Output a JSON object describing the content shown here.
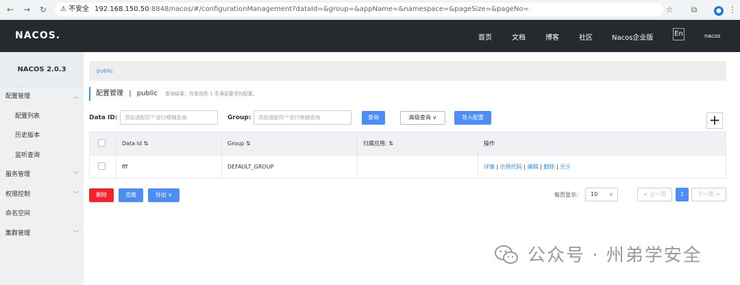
{
  "browser": {
    "security_label": "不安全",
    "url_host": "192.168.150.50",
    "url_rest": ":8848/nacos/#/configurationManagement?dataId=&group=&appName=&namespace=&pageSize=&pageNo="
  },
  "topnav": {
    "logo": "NACOS.",
    "links": [
      "首页",
      "文档",
      "博客",
      "社区",
      "Nacos企业版"
    ],
    "lang": "En",
    "user": "nacos"
  },
  "sidebar": {
    "version": "NACOS 2.0.3",
    "items": [
      {
        "label": "配置管理"
      },
      {
        "label": "配置列表"
      },
      {
        "label": "历史版本"
      },
      {
        "label": "监听查询"
      },
      {
        "label": "服务管理"
      },
      {
        "label": "权限控制"
      },
      {
        "label": "命名空间"
      },
      {
        "label": "集群管理"
      }
    ]
  },
  "main": {
    "breadcrumb": "public",
    "title": "配置管理",
    "title_sep": "|",
    "title_ns": "public",
    "result_text": "查询结果：共查询到 1 条满足要求的配置。",
    "dataid_label": "Data ID:",
    "dataid_placeholder": "添加通配符'*'进行模糊查询",
    "group_label": "Group:",
    "group_placeholder": "添加通配符'*'进行模糊查询",
    "query_btn": "查询",
    "adv_query_btn": "高级查询",
    "import_btn": "导入配置",
    "add_btn": "+"
  },
  "table": {
    "headers": [
      "Data Id",
      "Group",
      "归属应用:",
      "操作"
    ],
    "rows": [
      {
        "data_id": "fff",
        "group": "DEFAULT_GROUP",
        "app": "",
        "actions": [
          "详情",
          "示例代码",
          "编辑",
          "删除"
        ],
        "more": "更多"
      }
    ],
    "action_sep": "|"
  },
  "footer": {
    "delete_btn": "删除",
    "clone_btn": "克隆",
    "export_btn": "导出",
    "page_size_label": "每页显示:",
    "page_size": "10",
    "prev": "< 上一页",
    "current_page": "1",
    "next": "下一页 >"
  },
  "watermark": "公众号 · 州弟学安全",
  "colors": {
    "accent": "#2e8fe6",
    "nav_bg": "#252a2f",
    "danger": "#f5222d",
    "primary_btn": "#4d8ef6"
  }
}
